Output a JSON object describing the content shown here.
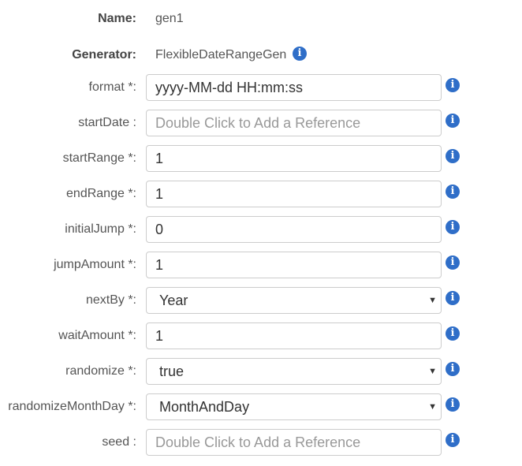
{
  "header": {
    "name_label": "Name:",
    "name_value": "gen1",
    "generator_label": "Generator:",
    "generator_value": "FlexibleDateRangeGen"
  },
  "info_icon_glyph": "i",
  "info_icon_name": "info-circle-icon",
  "accent_color": "#2f6ec8",
  "fields": [
    {
      "label": "format *:",
      "type": "text",
      "value": "yyyy-MM-dd HH:mm:ss",
      "placeholder": ""
    },
    {
      "label": "startDate :",
      "type": "text",
      "value": "",
      "placeholder": "Double Click to Add a Reference"
    },
    {
      "label": "startRange *:",
      "type": "text",
      "value": "1",
      "placeholder": ""
    },
    {
      "label": "endRange *:",
      "type": "text",
      "value": "1",
      "placeholder": ""
    },
    {
      "label": "initialJump *:",
      "type": "text",
      "value": "0",
      "placeholder": ""
    },
    {
      "label": "jumpAmount *:",
      "type": "text",
      "value": "1",
      "placeholder": ""
    },
    {
      "label": "nextBy *:",
      "type": "select",
      "value": "Year",
      "placeholder": ""
    },
    {
      "label": "waitAmount *:",
      "type": "text",
      "value": "1",
      "placeholder": ""
    },
    {
      "label": "randomize *:",
      "type": "select",
      "value": "true",
      "placeholder": ""
    },
    {
      "label": "randomizeMonthDay *:",
      "type": "select",
      "value": "MonthAndDay",
      "placeholder": ""
    },
    {
      "label": "seed :",
      "type": "text",
      "value": "",
      "placeholder": "Double Click to Add a Reference"
    }
  ],
  "caret_glyph": "▼"
}
